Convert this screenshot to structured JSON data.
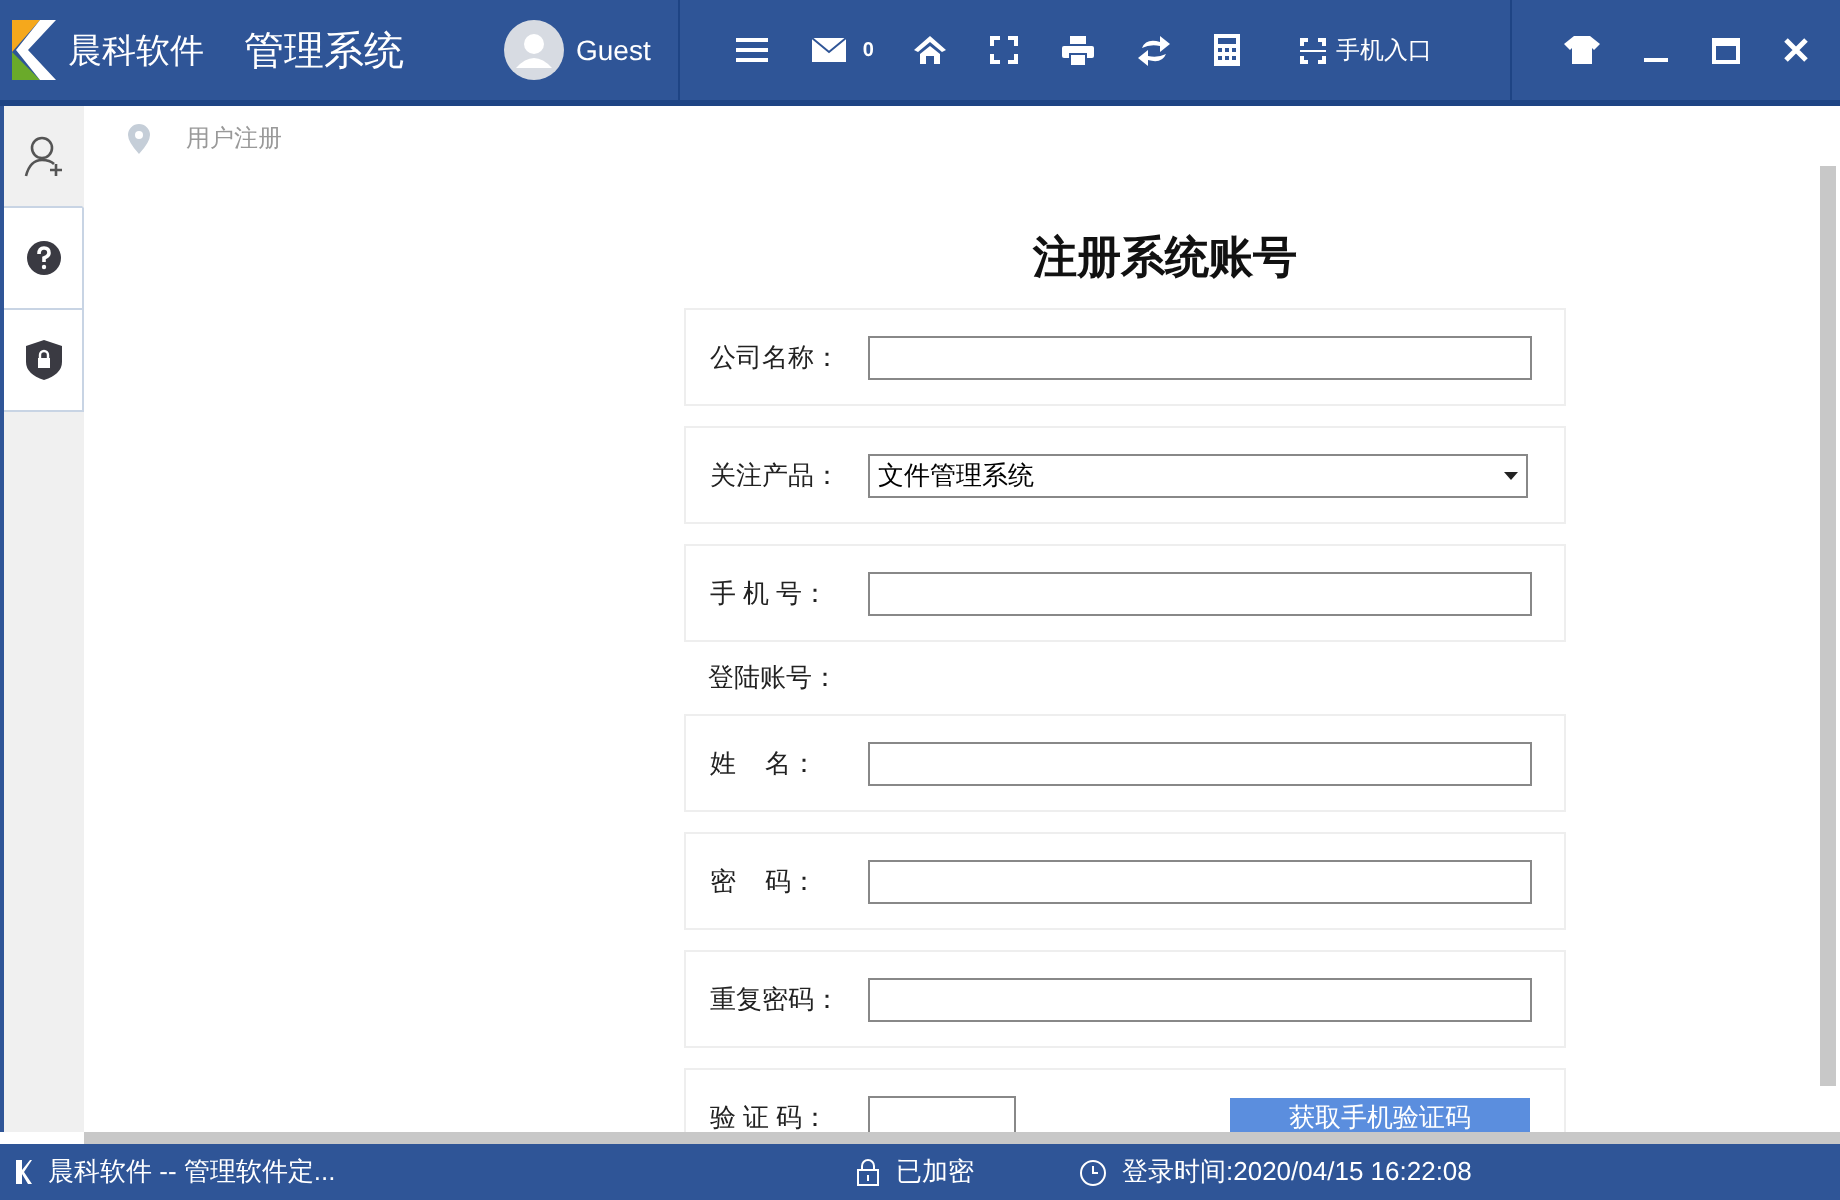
{
  "header": {
    "brand": "晨科软件",
    "title": "管理系统",
    "user": "Guest",
    "mail_count": "0",
    "mobile_entry": "手机入口"
  },
  "sidebar": {
    "items": [
      {
        "selected": true
      },
      {
        "selected": false
      },
      {
        "selected": false
      }
    ]
  },
  "breadcrumb": "用户注册",
  "form": {
    "title": "注册系统账号",
    "rows": [
      {
        "kind": "input",
        "label": "公司名称："
      },
      {
        "kind": "select",
        "label": "关注产品：",
        "value": "文件管理系统"
      },
      {
        "kind": "input",
        "label": "手 机 号："
      },
      {
        "kind": "section",
        "label": "登陆账号："
      },
      {
        "kind": "input",
        "label": "姓    名："
      },
      {
        "kind": "input",
        "label": "密    码："
      },
      {
        "kind": "input",
        "label": "重复密码："
      },
      {
        "kind": "code",
        "label": "验 证 码：",
        "button": "获取手机验证码"
      }
    ]
  },
  "status_bar": {
    "app": "晨科软件 -- 管理软件定...",
    "encryption": "已加密",
    "login_time": "登录时间:2020/04/15 16:22:08"
  }
}
